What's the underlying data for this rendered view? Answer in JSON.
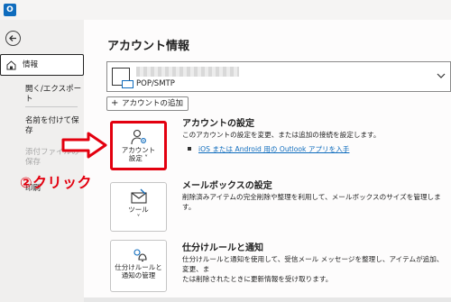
{
  "app": {
    "icon_label": "O"
  },
  "sidebar": {
    "info": "情報",
    "open_export": "開く/エクスポート",
    "save_as": "名前を付けて保存",
    "save_attachments": "添付ファイルの保存",
    "print": "印刷"
  },
  "main": {
    "title": "アカウント情報",
    "account": {
      "type": "POP/SMTP"
    },
    "add_account_label": "アカウントの追加",
    "sections": [
      {
        "tile_label_1": "アカウント",
        "tile_label_2": "設定",
        "title": "アカウントの設定",
        "description": "このアカウントの設定を変更、または追加の接続を設定します。",
        "link": "iOS または Android 用の Outlook アプリを入手"
      },
      {
        "tile_label_1": "ツール",
        "title": "メールボックスの設定",
        "description": "削除済みアイテムの完全削除や整理を利用して、メールボックスのサイズを管理します。"
      },
      {
        "tile_label_1": "仕分けルールと",
        "tile_label_2": "通知の管理",
        "title": "仕分けルールと通知",
        "description_1": "仕分けルールと通知を使用して、受信メール メッセージを整理し、アイテムが追加、変更、ま",
        "description_2": "たは削除されたときに更新情報を受け取ります。"
      }
    ]
  },
  "annotation": {
    "text": "②クリック",
    "color": "#e3000f"
  }
}
